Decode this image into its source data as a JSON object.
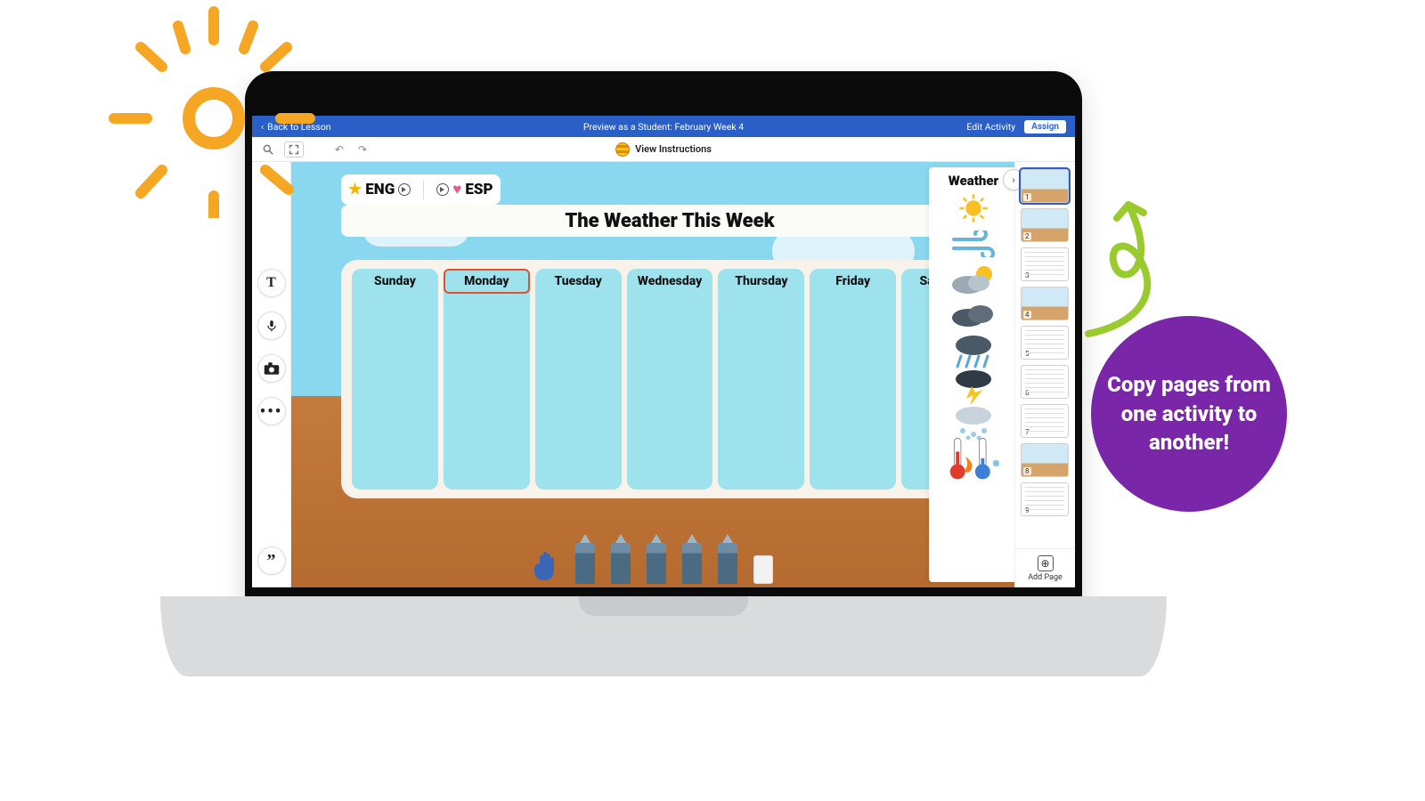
{
  "topbar": {
    "back_label": "Back to Lesson",
    "title": "Preview as a Student: February Week 4",
    "edit_label": "Edit Activity",
    "assign_label": "Assign"
  },
  "utilbar": {
    "view_instructions": "View Instructions"
  },
  "tools": {
    "text": "T",
    "mic": "mic",
    "cam": "cam",
    "more": "…",
    "quote": "”"
  },
  "canvas": {
    "lang": {
      "eng": "ENG",
      "esp": "ESP"
    },
    "title": "The Weather This Week",
    "days": [
      "Sunday",
      "Monday",
      "Tuesday",
      "Wednesday",
      "Thursday",
      "Friday",
      "Saturday"
    ],
    "selected_day_index": 1,
    "weather_panel_title": "Weather",
    "weather_icons": [
      "sunny",
      "wind",
      "partly-cloudy",
      "cloudy",
      "rain",
      "thunder",
      "snow",
      "hot-cold"
    ]
  },
  "pages": {
    "count": 9,
    "selected": 1,
    "add_label": "Add Page"
  },
  "callout": "Copy pages from one activity to another!"
}
